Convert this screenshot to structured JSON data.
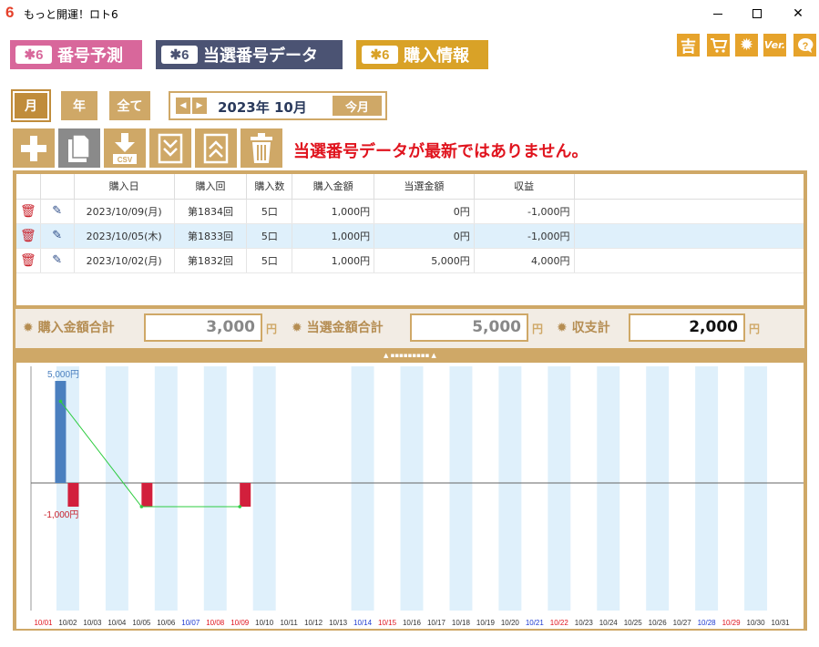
{
  "window": {
    "title": "もっと開運！ロト6",
    "icon": "6",
    "minimize": "—",
    "maximize": "□",
    "close": "✕"
  },
  "tabs": [
    {
      "badge": "6",
      "label": "番号予測"
    },
    {
      "badge": "6",
      "label": "当選番号データ"
    },
    {
      "badge": "6",
      "label": "購入情報"
    }
  ],
  "tool_icons": {
    "fortune": "吉",
    "cart": "cart-icon",
    "settings": "gear-icon",
    "version": "Ver.",
    "help": "help-icon"
  },
  "period": {
    "month": "月",
    "year": "年",
    "all": "全て",
    "current": "2023年 10月",
    "this_month": "今月"
  },
  "actions": {
    "csv_label": "CSV"
  },
  "warning": "当選番号データが最新ではありません。",
  "table": {
    "headers": [
      "",
      "",
      "購入日",
      "購入回",
      "購入数",
      "購入金額",
      "当選金額",
      "収益"
    ],
    "rows": [
      {
        "date": "2023/10/09(月)",
        "round": "第1834回",
        "count": "5口",
        "cost": "1,000円",
        "prize": "0円",
        "profit": "-1,000円"
      },
      {
        "date": "2023/10/05(木)",
        "round": "第1833回",
        "count": "5口",
        "cost": "1,000円",
        "prize": "0円",
        "profit": "-1,000円"
      },
      {
        "date": "2023/10/02(月)",
        "round": "第1832回",
        "count": "5口",
        "cost": "1,000円",
        "prize": "5,000円",
        "profit": "4,000円"
      }
    ]
  },
  "totals": {
    "purchase_label": "購入金額合計",
    "purchase_value": "3,000",
    "winning_label": "当選金額合計",
    "winning_value": "5,000",
    "balance_label": "収支計",
    "balance_value": "2,000",
    "unit": "円"
  },
  "colors": {
    "accent": "#cfa867",
    "positive_bar": "#4a7fbf",
    "negative_bar": "#d21f3c",
    "line": "#2ecc40",
    "weekend_col": "#dff0fb"
  },
  "chart_data": {
    "type": "bar",
    "categories": [
      "10/01",
      "10/02",
      "10/03",
      "10/04",
      "10/05",
      "10/06",
      "10/07",
      "10/08",
      "10/09",
      "10/10",
      "10/11",
      "10/12",
      "10/13",
      "10/14",
      "10/15",
      "10/16",
      "10/17",
      "10/18",
      "10/19",
      "10/20",
      "10/21",
      "10/22",
      "10/23",
      "10/24",
      "10/25",
      "10/26",
      "10/27",
      "10/28",
      "10/29",
      "10/30",
      "10/31"
    ],
    "category_colors": [
      "red",
      "black",
      "black",
      "black",
      "black",
      "black",
      "blue",
      "red",
      "red",
      "black",
      "black",
      "black",
      "black",
      "blue",
      "red",
      "black",
      "black",
      "black",
      "black",
      "black",
      "blue",
      "red",
      "black",
      "black",
      "black",
      "black",
      "black",
      "blue",
      "red",
      "black",
      "black"
    ],
    "shaded_categories": [
      "10/02",
      "10/04",
      "10/06",
      "10/08",
      "10/10",
      "10/14",
      "10/16",
      "10/18",
      "10/20",
      "10/22",
      "10/24",
      "10/26",
      "10/28",
      "10/30"
    ],
    "series": [
      {
        "name": "当選金額",
        "color": "#4a7fbf",
        "points": [
          [
            "10/02",
            5000
          ]
        ]
      },
      {
        "name": "購入金額",
        "color": "#d21f3c",
        "points": [
          [
            "10/02",
            -1000
          ],
          [
            "10/05",
            -1000
          ],
          [
            "10/09",
            -1000
          ]
        ]
      },
      {
        "name": "収益",
        "color": "#2ecc40",
        "points": [
          [
            "10/02",
            4000
          ],
          [
            "10/05",
            -1000
          ],
          [
            "10/09",
            -1000
          ]
        ]
      }
    ],
    "y_labels": [
      "5,000円",
      "-1,000円"
    ],
    "ylim": [
      -6000,
      5000
    ]
  }
}
